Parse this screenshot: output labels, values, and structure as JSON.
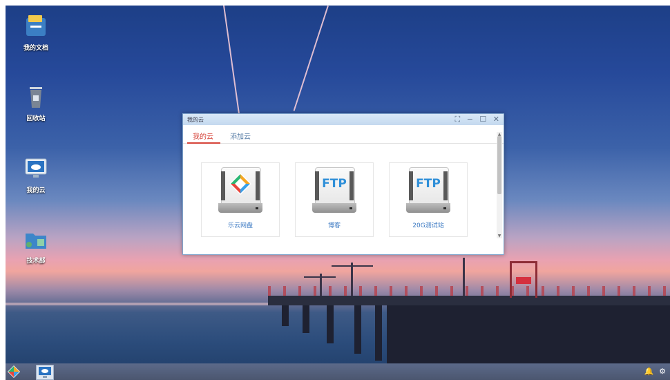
{
  "desktop": {
    "icons": [
      {
        "label": "我的文档",
        "icon": "document-folder-icon"
      },
      {
        "label": "回收站",
        "icon": "recycle-bin-icon"
      },
      {
        "label": "我的云",
        "icon": "cloud-monitor-icon"
      },
      {
        "label": "技术部",
        "icon": "network-folder-icon"
      }
    ]
  },
  "window": {
    "title": "我的云",
    "controls": {
      "fullscreen": "⛶",
      "minimize": "−",
      "maximize": "☐",
      "close": "✕"
    },
    "tabs": [
      {
        "label": "我的云",
        "active": true
      },
      {
        "label": "添加云",
        "active": false
      }
    ],
    "items": [
      {
        "label": "乐云网盘",
        "icon": "leyun-drive-icon",
        "badge": ""
      },
      {
        "label": "博客",
        "icon": "ftp-drive-icon",
        "badge": "FTP"
      },
      {
        "label": "20G测试站",
        "icon": "ftp-drive-icon",
        "badge": "FTP"
      }
    ]
  },
  "taskbar": {
    "start_icon": "start-menu-icon",
    "app_icon": "cloud-monitor-icon",
    "tray": {
      "bell": "🔔",
      "settings": "⚙"
    }
  },
  "colors": {
    "accent_red": "#d6443a",
    "link_blue": "#3a78c2",
    "ftp_blue": "#2f8fd8"
  }
}
